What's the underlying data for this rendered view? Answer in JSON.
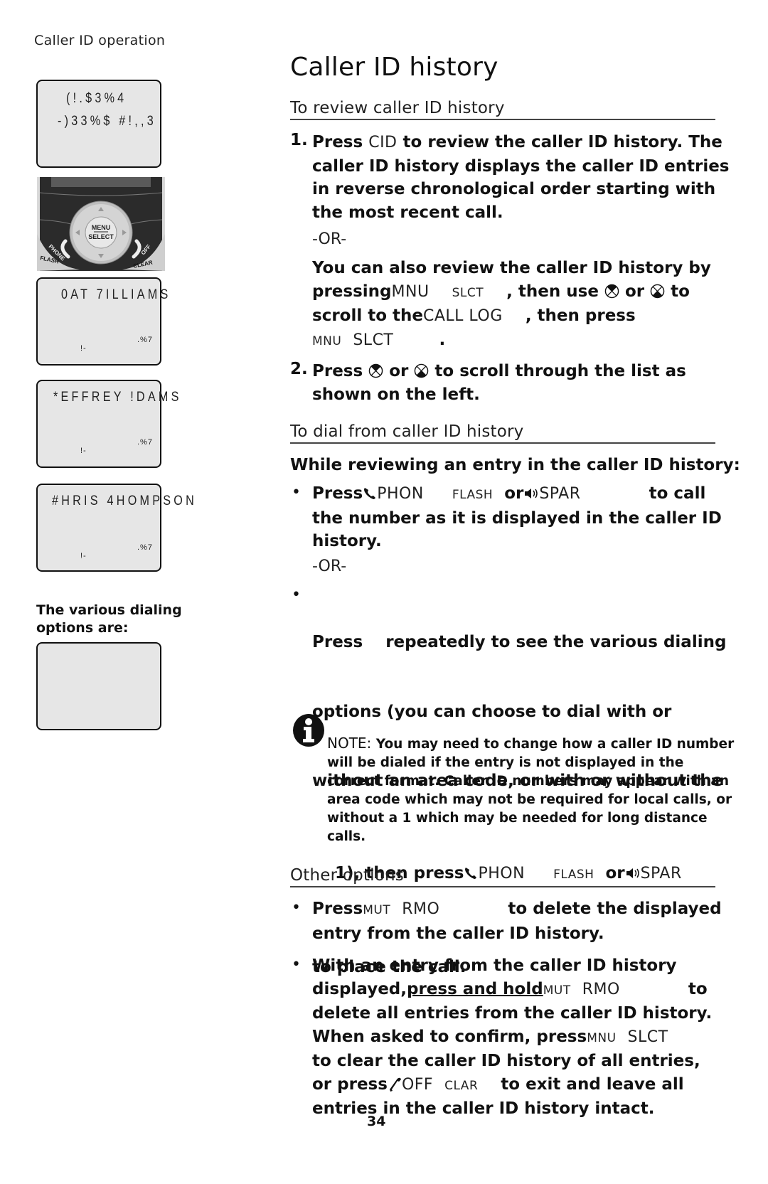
{
  "running_head": "Caller ID operation",
  "left_column": {
    "screens": [
      {
        "line1": "(!.$3%4",
        "line2": "-)33%$ #!,,3",
        "small_right": "",
        "small_left": ""
      },
      {
        "line1": "0AT 7ILLIAMS",
        "line2": "",
        "small_right": ".%7",
        "small_left": "!-"
      },
      {
        "line1": "*EFFREY !DAMS",
        "line2": "",
        "small_right": ".%7",
        "small_left": "!-"
      },
      {
        "line1": "#HRIS 4HOMPSON",
        "line2": "",
        "small_right": ".%7",
        "small_left": "!-"
      },
      {
        "line1": "",
        "line2": "",
        "small_right": "",
        "small_left": ""
      }
    ],
    "handset": {
      "menu_label": "MENU",
      "select_label": "SELECT",
      "phone_label": "PHONE",
      "flash_label": "FLASH",
      "off_label": "OFF",
      "clear_label": "CLEAR"
    },
    "caption": "The various dialing options are:"
  },
  "main": {
    "title": "Caller ID history",
    "sections": [
      {
        "heading": "To review caller ID history",
        "step1": {
          "number": "1.",
          "press": "Press",
          "key_cid": "CID",
          "text": "to review the caller ID history. The caller ID history displays the caller ID entries in reverse chronological order starting with the most recent call.",
          "or": "-OR-",
          "alt_a": "You can also review the caller ID history by",
          "alt_pressing": "pressing",
          "key_mnu": "MNU",
          "key_slct_sm": "SLCT",
          "alt_then_use": ", then use",
          "alt_or": "or",
          "alt_to": "to",
          "alt_scroll": "scroll to the",
          "key_call_log": "CALL LOG",
          "alt_then_press": ", then press",
          "key_mnu_sm": "MNU",
          "key_slct": "SLCT",
          "period": "."
        },
        "step2": {
          "number": "2.",
          "press": "Press",
          "or": "or",
          "text_a": "to scroll through the list as",
          "text_b": "shown on the left."
        }
      },
      {
        "heading": "To dial from caller ID history",
        "intro": "While reviewing an entry in the caller ID history:",
        "bullet1": {
          "press": "Press",
          "key_phon": "PHON",
          "key_flash": "FLASH",
          "or": "or",
          "key_spar": "SPAR",
          "text_a": "to call",
          "text_b": "the number as it is displayed in the caller ID",
          "text_c": "history."
        },
        "or": "-OR-",
        "bullet2": {
          "line1": "Press    repeatedly to see the various dialing",
          "line2": "options (you can choose to dial with or",
          "line3": "without an area code, or with or without the",
          "line4_a": "1), then press",
          "key_phon": "PHON",
          "key_flash": "FLASH",
          "or": "or",
          "key_spar": "SPAR",
          "line5": "to place the call."
        },
        "note": {
          "label": "NOTE:",
          "text": "You may need to change how a caller ID number will be dialed if the entry is not displayed in the correct format. Caller ID numbers may appear with an area code which may not be required for local calls, or without a 1 which may be needed for long distance calls."
        }
      },
      {
        "heading": "Other options",
        "bullet1": {
          "press": "Press",
          "key_mut": "MUT",
          "key_rmo": "RMO",
          "text_a": "to delete the displayed",
          "text_b": "entry from the caller ID history."
        },
        "bullet2": {
          "line1": "With an entry from the caller ID history",
          "line2_a": "displayed,",
          "line2_u": "press and hold",
          "key_mut": "MUT",
          "key_rmo": "RMO",
          "line2_b": "to",
          "line3": "delete all entries from the caller ID history.",
          "line4_a": "When asked to confirm, press",
          "key_mnu": "MNU",
          "key_slct": "SLCT",
          "line5": "to clear the caller ID history of all entries,",
          "line6_a": "or press",
          "key_off": "OFF",
          "key_clar": "CLAR",
          "line6_b": "to exit and leave all",
          "line7": "entries in the caller ID history intact."
        }
      }
    ]
  },
  "page_number": "34"
}
